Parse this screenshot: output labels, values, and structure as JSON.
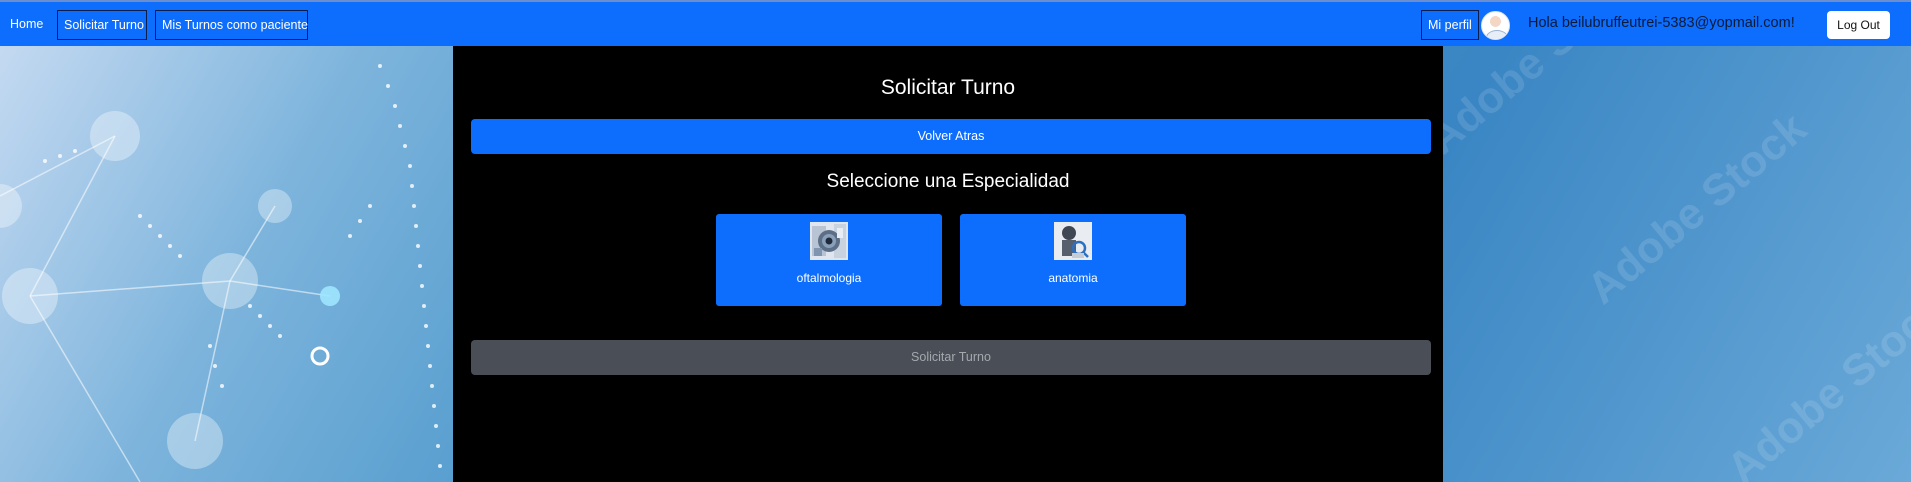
{
  "navbar": {
    "home_label": "Home",
    "solicitar_label": "Solicitar Turno",
    "mis_turnos_label": "Mis Turnos como paciente",
    "perfil_label": "Mi perfil",
    "greeting": "Hola beilubruffeutrei-5383@yopmail.com!",
    "logout_label": "Log Out"
  },
  "main": {
    "title": "Solicitar Turno",
    "back_label": "Volver Atras",
    "section_title": "Seleccione una Especialidad",
    "specialties": [
      {
        "label": "oftalmologia",
        "icon": "eye-exam-icon"
      },
      {
        "label": "anatomia",
        "icon": "stethoscope-doctor-icon"
      }
    ],
    "submit_label": "Solicitar Turno"
  },
  "colors": {
    "primary": "#0d6efd",
    "panel": "#000000",
    "disabled": "#4a4f57",
    "text_light": "#ffffff"
  }
}
